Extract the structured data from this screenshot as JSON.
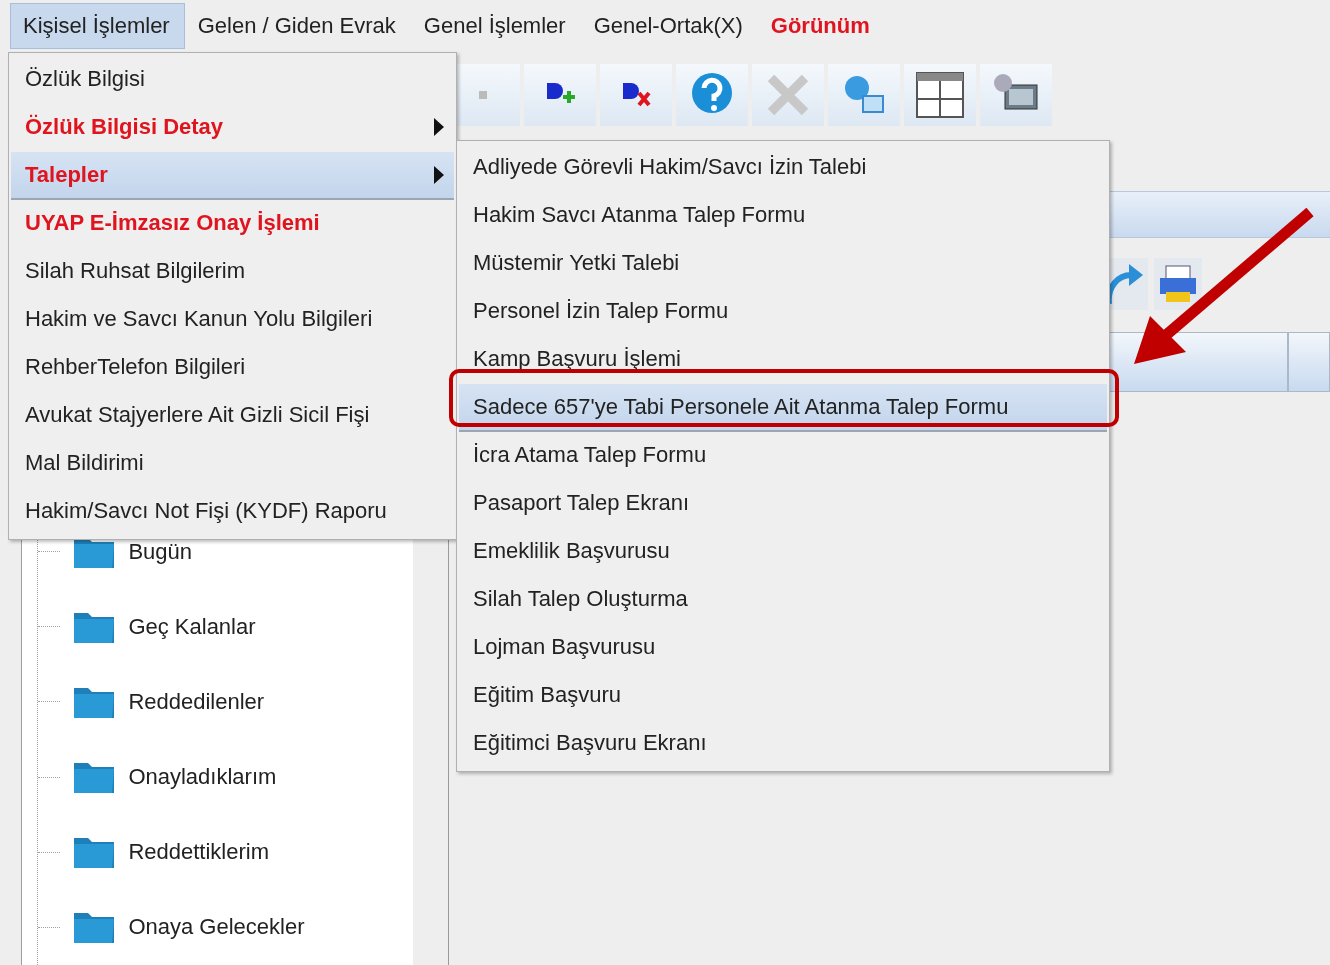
{
  "menubar": [
    {
      "label": "Kişisel İşlemler",
      "selected": true,
      "emphasis": false
    },
    {
      "label": "Gelen / Giden Evrak",
      "selected": false,
      "emphasis": false
    },
    {
      "label": "Genel İşlemler",
      "selected": false,
      "emphasis": false
    },
    {
      "label": "Genel-Ortak(X)",
      "selected": false,
      "emphasis": false
    },
    {
      "label": "Görünüm",
      "selected": false,
      "emphasis": true
    }
  ],
  "main_menu": {
    "items": [
      {
        "label": "Özlük Bilgisi",
        "selected": false,
        "emphasis": false,
        "has_submenu": false
      },
      {
        "label": "Özlük Bilgisi Detay",
        "selected": false,
        "emphasis": true,
        "has_submenu": true
      },
      {
        "label": "Talepler",
        "selected": true,
        "emphasis": true,
        "has_submenu": true
      },
      {
        "label": "UYAP E-İmzasız Onay İşlemi",
        "selected": false,
        "emphasis": true,
        "has_submenu": false
      },
      {
        "label": "Silah Ruhsat Bilgilerim",
        "selected": false,
        "emphasis": false,
        "has_submenu": false
      },
      {
        "label": "Hakim ve Savcı Kanun Yolu Bilgileri",
        "selected": false,
        "emphasis": false,
        "has_submenu": false
      },
      {
        "label": "RehberTelefon Bilgileri",
        "selected": false,
        "emphasis": false,
        "has_submenu": false
      },
      {
        "label": "Avukat Stajyerlere Ait Gizli Sicil Fişi",
        "selected": false,
        "emphasis": false,
        "has_submenu": false
      },
      {
        "label": "Mal Bildirimi",
        "selected": false,
        "emphasis": false,
        "has_submenu": false
      },
      {
        "label": "Hakim/Savcı Not Fişi (KYDF) Raporu",
        "selected": false,
        "emphasis": false,
        "has_submenu": false
      }
    ]
  },
  "submenu": {
    "items": [
      {
        "label": "Adliyede Görevli Hakim/Savcı İzin Talebi",
        "selected": false
      },
      {
        "label": "Hakim Savcı Atanma Talep Formu",
        "selected": false
      },
      {
        "label": "Müstemir Yetki Talebi",
        "selected": false
      },
      {
        "label": "Personel İzin Talep Formu",
        "selected": false
      },
      {
        "label": "Kamp Başvuru İşlemi",
        "selected": false
      },
      {
        "label": "Sadece 657'ye Tabi Personele Ait Atanma Talep Formu",
        "selected": true
      },
      {
        "label": "İcra Atama Talep Formu",
        "selected": false
      },
      {
        "label": "Pasaport Talep Ekranı",
        "selected": false
      },
      {
        "label": "Emeklilik Başvurusu",
        "selected": false
      },
      {
        "label": "Silah Talep Oluşturma",
        "selected": false
      },
      {
        "label": "Lojman Başvurusu",
        "selected": false
      },
      {
        "label": "Eğitim Başvuru",
        "selected": false
      },
      {
        "label": "Eğitimci Başvuru Ekranı",
        "selected": false
      }
    ]
  },
  "tree": {
    "items": [
      {
        "label": "Bugün"
      },
      {
        "label": "Geç Kalanlar"
      },
      {
        "label": "Reddedilenler"
      },
      {
        "label": "Onayladıklarım"
      },
      {
        "label": "Reddettiklerim"
      },
      {
        "label": "Onaya Gelecekler"
      }
    ]
  }
}
